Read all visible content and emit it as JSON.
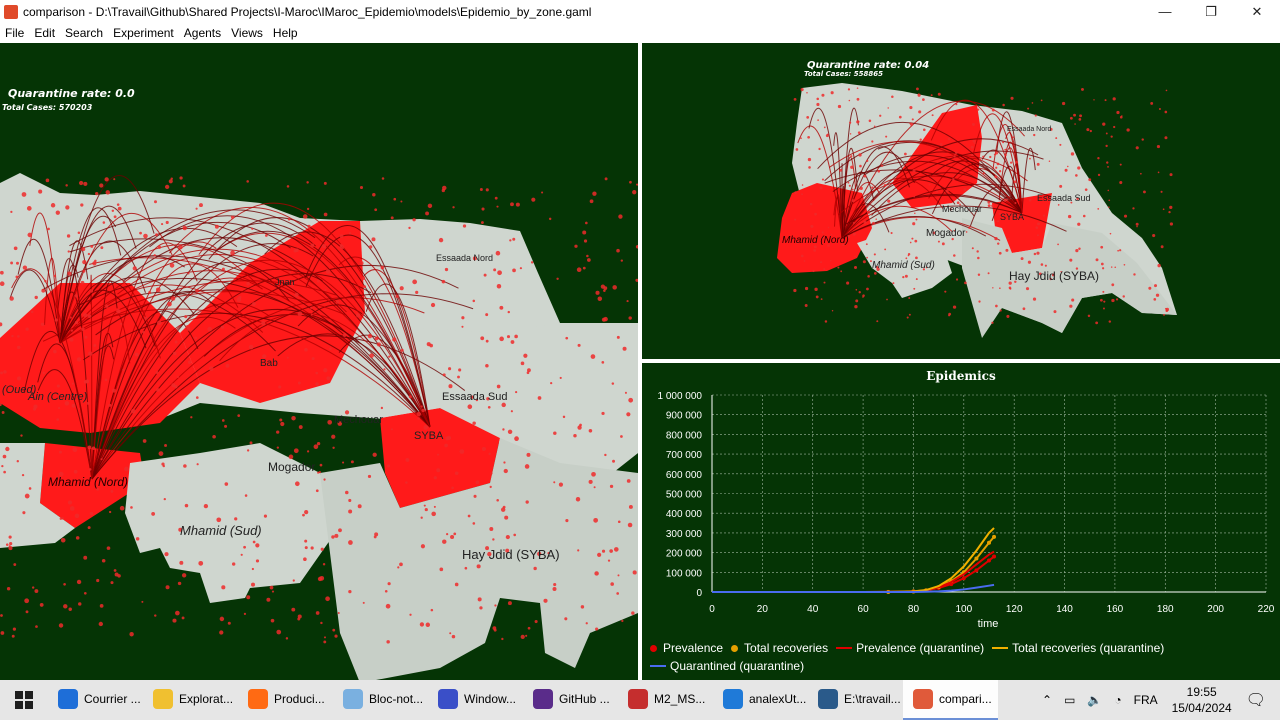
{
  "window": {
    "title": "comparison - D:\\Travail\\Github\\Shared Projects\\I-Maroc\\IMaroc_Epidemio\\models\\Epidemio_by_zone.gaml",
    "minimize": "—",
    "maximize": "❐",
    "close": "✕"
  },
  "menu": [
    "File",
    "Edit",
    "Search",
    "Experiment",
    "Agents",
    "Views",
    "Help"
  ],
  "view1": {
    "title": "Quarantine rate: 0.0",
    "total": "Total Cases: 570203",
    "labels": [
      "Mhamid (Nord)",
      "Mhamid (Sud)",
      "Mogador",
      "Hay Jdid (SYBA)",
      "SYBA",
      "Mechouar",
      "Essaada Sud",
      "Ain (Centre)",
      "Essaada Nord",
      "Jnan",
      "Bab",
      "(Oued)"
    ]
  },
  "view2": {
    "title": "Quarantine rate: 0.04",
    "total": "Total Cases: 558865",
    "labels": [
      "Mhamid (Nord)",
      "Mhamid (Sud)",
      "Mogador",
      "Hay Jdid (SYBA)",
      "SYBA",
      "Mechouar",
      "Essaada Sud",
      "Essaada Nord"
    ]
  },
  "chart_data": {
    "type": "line",
    "title": "Epidemics",
    "xlabel": "time",
    "ylabel": "",
    "xlim": [
      0,
      220
    ],
    "ylim": [
      0,
      1000000
    ],
    "xticks": [
      "0",
      "20",
      "40",
      "60",
      "80",
      "100",
      "120",
      "140",
      "160",
      "180",
      "200",
      "220"
    ],
    "yticks": [
      "0",
      "100 000",
      "200 000",
      "300 000",
      "400 000",
      "500 000",
      "600 000",
      "700 000",
      "800 000",
      "900 000",
      "1 000 000"
    ],
    "series": [
      {
        "name": "Prevalence",
        "style": "dot",
        "color": "#e00000",
        "x": [
          0,
          20,
          40,
          60,
          70,
          80,
          85,
          90,
          95,
          100,
          105,
          110,
          112
        ],
        "y": [
          0,
          0,
          0,
          0,
          500,
          3000,
          8000,
          20000,
          40000,
          70000,
          110000,
          160000,
          180000
        ]
      },
      {
        "name": "Total recoveries",
        "style": "dot",
        "color": "#e5a000",
        "x": [
          0,
          20,
          40,
          60,
          70,
          80,
          85,
          90,
          95,
          100,
          105,
          110,
          112
        ],
        "y": [
          0,
          0,
          0,
          0,
          300,
          2500,
          8000,
          25000,
          55000,
          100000,
          170000,
          250000,
          280000
        ]
      },
      {
        "name": "Prevalence (quarantine)",
        "style": "line",
        "color": "#e00000",
        "x": [
          0,
          20,
          40,
          60,
          70,
          80,
          85,
          90,
          95,
          100,
          105,
          110,
          112
        ],
        "y": [
          0,
          0,
          0,
          0,
          600,
          3500,
          9000,
          24000,
          50000,
          90000,
          140000,
          190000,
          205000
        ]
      },
      {
        "name": "Total recoveries (quarantine)",
        "style": "line",
        "color": "#f0b000",
        "x": [
          0,
          20,
          40,
          60,
          70,
          80,
          85,
          90,
          95,
          100,
          105,
          110,
          112
        ],
        "y": [
          0,
          0,
          0,
          0,
          400,
          3000,
          10000,
          30000,
          70000,
          130000,
          210000,
          300000,
          325000
        ]
      },
      {
        "name": "Quarantined (quarantine)",
        "style": "line",
        "color": "#4a6cf0",
        "x": [
          0,
          20,
          40,
          60,
          70,
          80,
          85,
          90,
          95,
          100,
          105,
          110,
          112
        ],
        "y": [
          0,
          0,
          0,
          0,
          0,
          300,
          1000,
          3000,
          7000,
          13000,
          22000,
          32000,
          36000
        ]
      }
    ],
    "grid": true,
    "legend": "bottom"
  },
  "taskbar": {
    "items": [
      {
        "label": "Courrier ...",
        "color": "#1e6ed8"
      },
      {
        "label": "Explorat...",
        "color": "#f0c030"
      },
      {
        "label": "Produci...",
        "color": "#ff6a13"
      },
      {
        "label": "Bloc-not...",
        "color": "#7ab0e0"
      },
      {
        "label": "Window...",
        "color": "#3a4fc8"
      },
      {
        "label": "GitHub ...",
        "color": "#5a2c8a"
      },
      {
        "label": "M2_MS...",
        "color": "#c52e2e"
      },
      {
        "label": "analexUt...",
        "color": "#1f7ad8"
      },
      {
        "label": "E:\\travail...",
        "color": "#2a5a8a"
      },
      {
        "label": "compari...",
        "color": "#e05a3a"
      }
    ],
    "lang": "FRA",
    "time": "19:55",
    "date": "15/04/2024"
  }
}
